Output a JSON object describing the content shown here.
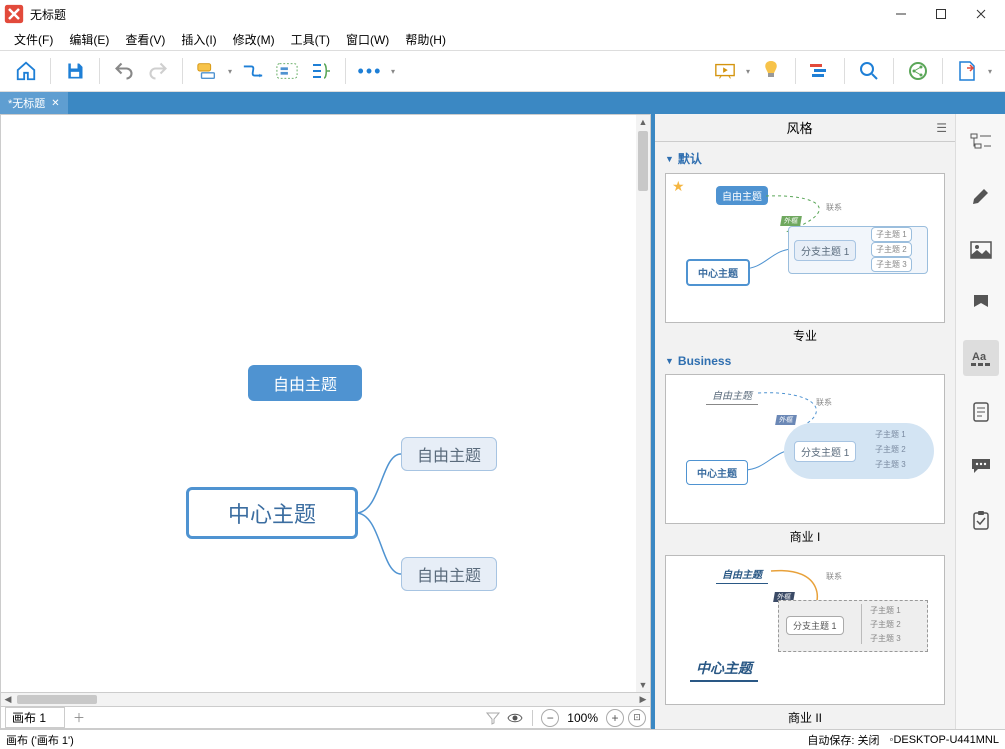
{
  "window": {
    "title": "无标题"
  },
  "menu": [
    "文件(F)",
    "编辑(E)",
    "查看(V)",
    "插入(I)",
    "修改(M)",
    "工具(T)",
    "窗口(W)",
    "帮助(H)"
  ],
  "tab": {
    "label": "*无标题",
    "close": "✕"
  },
  "mindmap": {
    "center": "中心主题",
    "free_main": "自由主题",
    "free1": "自由主题",
    "free2": "自由主题"
  },
  "sheet": {
    "name": "画布 1",
    "zoom": "100%"
  },
  "rpanel": {
    "title": "风格",
    "sections": {
      "default": {
        "label": "默认",
        "thumb_caption": "专业"
      },
      "business": {
        "label": "Business",
        "thumb1_caption": "商业 I",
        "thumb2_caption": "商业 II"
      }
    },
    "thumb": {
      "free": "自由主题",
      "center": "中心主题",
      "branch": "分支主题 1",
      "sub1": "子主题 1",
      "sub2": "子主题 2",
      "sub3": "子主题 3",
      "rel": "联系",
      "tag": "外框"
    }
  },
  "status": {
    "left": "画布 ('画布 1')",
    "autosave": "自动保存: 关闭",
    "host_prefix": "◦ ",
    "host": "DESKTOP-U441MNL"
  }
}
